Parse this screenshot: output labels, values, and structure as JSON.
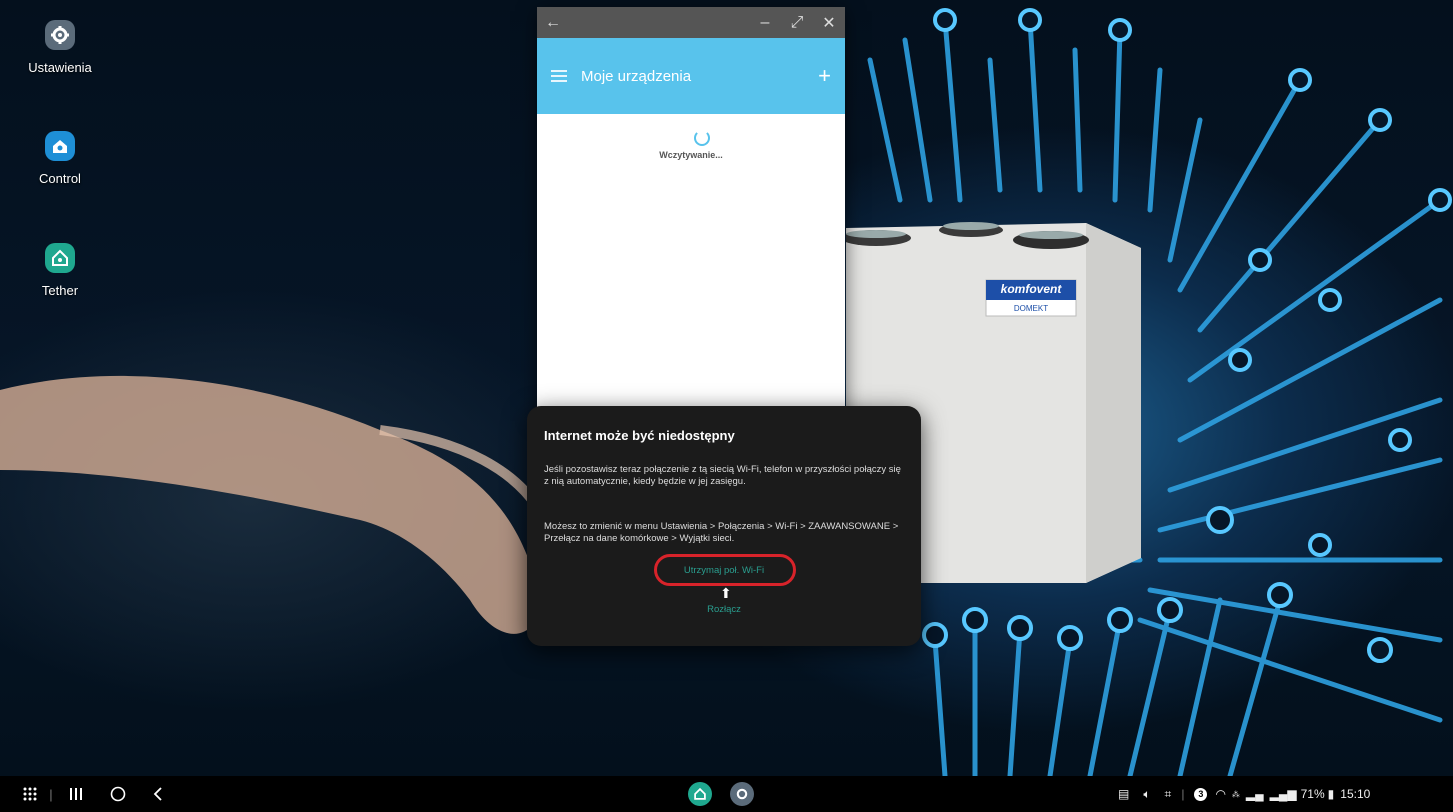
{
  "desktop": {
    "icons": [
      {
        "label": "Ustawienia",
        "icon": "gear-icon"
      },
      {
        "label": "Control",
        "icon": "komfovent-control-icon"
      },
      {
        "label": "Tether",
        "icon": "home-tether-icon"
      }
    ]
  },
  "window": {
    "app_bar_title": "Moje urządzenia",
    "loading_text": "Wczytywanie..."
  },
  "device_image": {
    "brand": "komfovent",
    "model": "DOMEKT"
  },
  "dialog": {
    "title": "Internet może być niedostępny",
    "paragraph1": "Jeśli pozostawisz teraz połączenie z tą siecią Wi-Fi, telefon w przyszłości połączy się z nią automatycznie, kiedy będzie w jej zasięgu.",
    "paragraph2": "Możesz to zmienić w menu Ustawienia > Połączenia > Wi-Fi > ZAAWANSOWANE > Przełącz na dane komórkowe > Wyjątki sieci.",
    "keep_wifi_button": "Utrzymaj poł. Wi-Fi",
    "disconnect_button": "Rozłącz"
  },
  "status": {
    "battery": "71%",
    "time": "15:10",
    "notification_count": "3"
  },
  "colors": {
    "app_bar": "#58c3ec",
    "dialog_button": "#2a9e8f",
    "highlight": "#d8232a"
  }
}
